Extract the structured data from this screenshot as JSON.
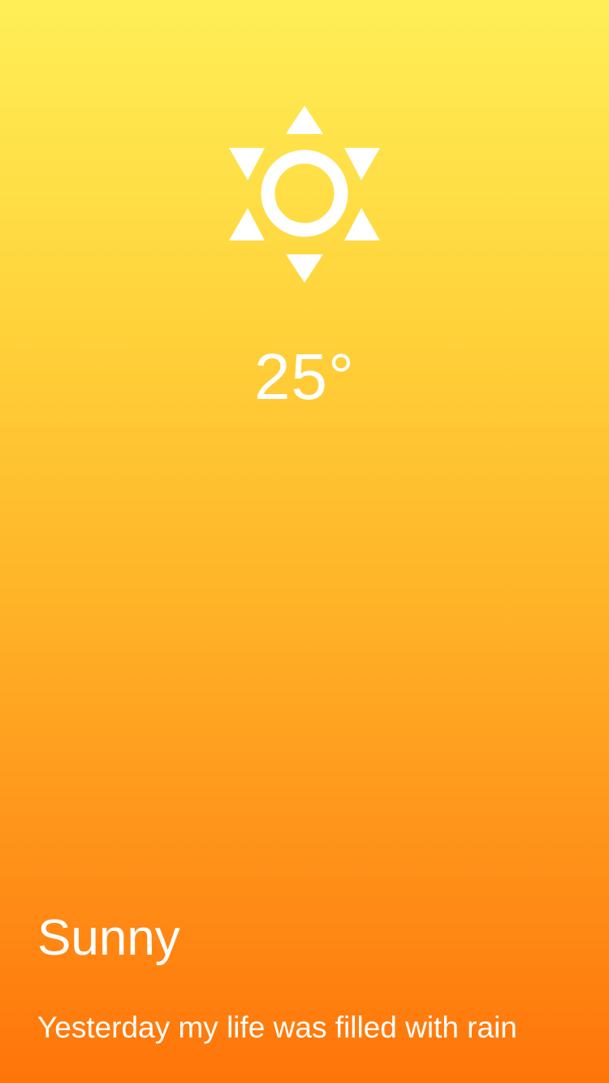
{
  "weather": {
    "icon": "sun-icon",
    "temperature": "25°",
    "condition": "Sunny",
    "description": "Yesterday my life was filled with rain"
  },
  "colors": {
    "gradient_top": "#FFEF57",
    "gradient_bottom": "#FF7409",
    "text": "#FFFFFF"
  }
}
